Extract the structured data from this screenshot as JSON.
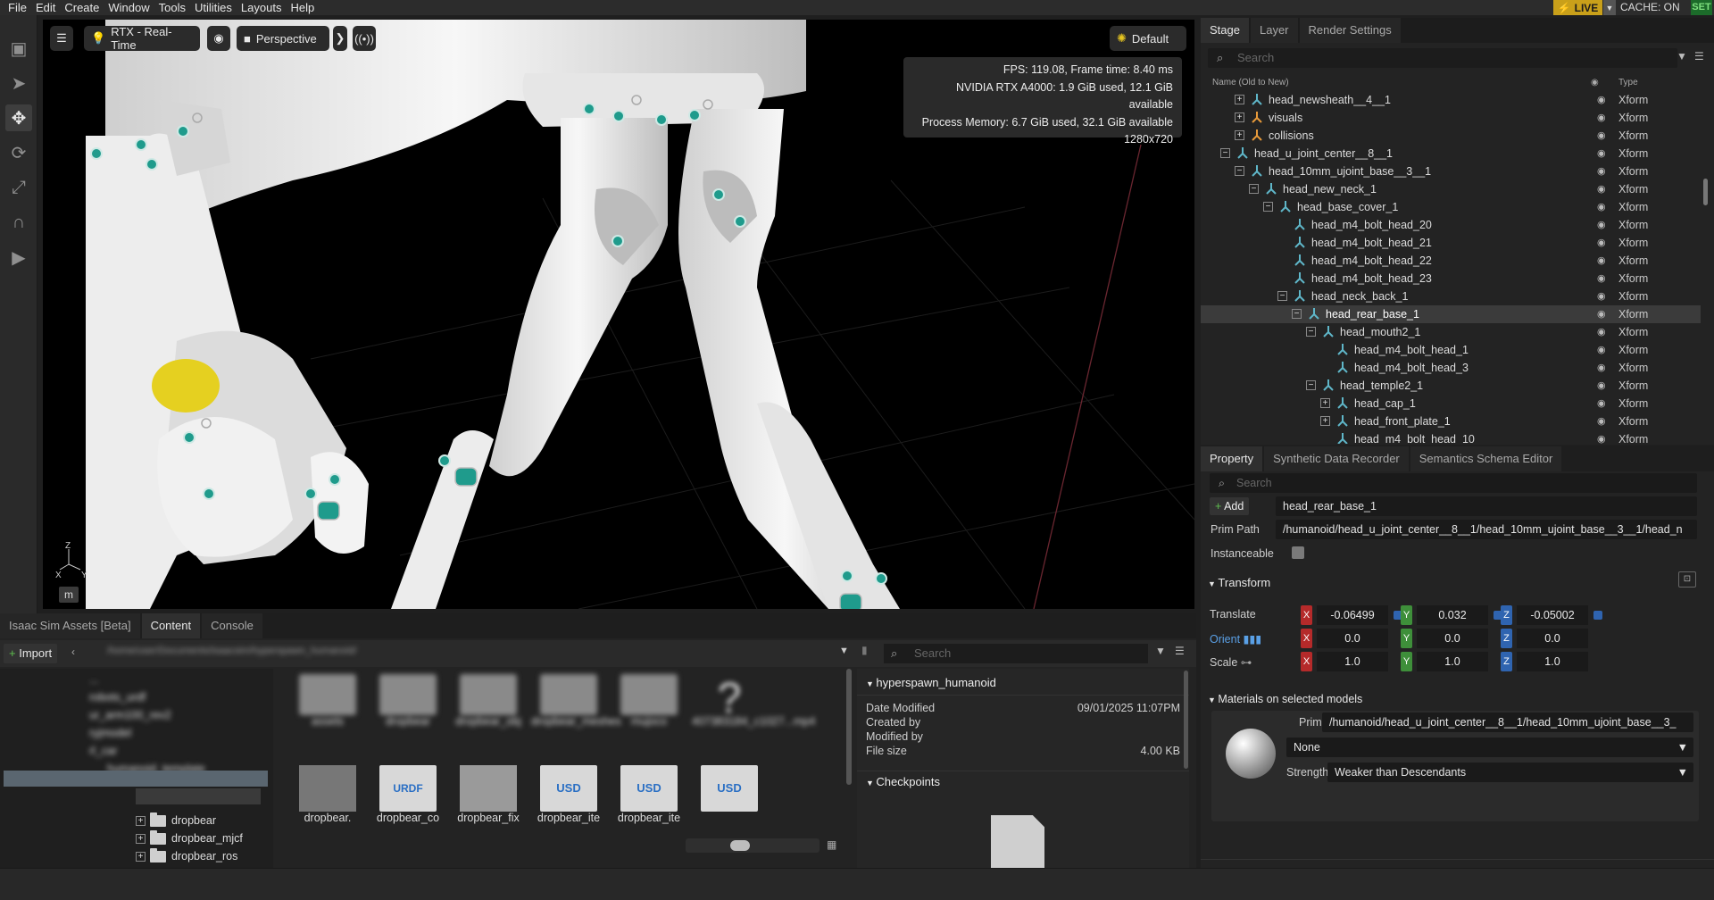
{
  "menu": [
    "File",
    "Edit",
    "Create",
    "Window",
    "Tools",
    "Utilities",
    "Layouts",
    "Help"
  ],
  "status": {
    "live_label": "LIVE",
    "cache_label": "CACHE: ON",
    "set_label": "SET"
  },
  "viewport": {
    "render_mode": "RTX - Real-Time",
    "camera": "Perspective",
    "lighting": "Default",
    "stats": [
      "FPS: 119.08, Frame time: 8.40 ms",
      "NVIDIA RTX A4000: 1.9 GiB used, 12.1 GiB available",
      "Process Memory: 6.7 GiB used, 32.1 GiB available",
      "1280x720"
    ],
    "axis_labels": {
      "z": "Z",
      "x": "X",
      "y": "Y"
    },
    "unit": "m",
    "colors": {
      "joint": "#1f9b8c",
      "part": "#f2f2f2",
      "accent": "#e5d020"
    }
  },
  "content": {
    "tabs": [
      "Isaac Sim Assets [Beta]",
      "Content",
      "Console"
    ],
    "active_tab": "Content",
    "import_label": "Import",
    "path": "/home/user/Documents/isaacsim/hyperspawn_humanoid/",
    "search_placeholder": "Search",
    "tree_blurred": [
      "...",
      "robots_urdf",
      "ur_arm100_rev2",
      "ryjmodel",
      "rl_car",
      "humanoid_template"
    ],
    "tree_visible": [
      {
        "label": "dropbear",
        "expander": "+"
      },
      {
        "label": "dropbear_mjcf",
        "expander": "+"
      },
      {
        "label": "dropbear_ros",
        "expander": "+"
      }
    ],
    "grid_blurred": [
      "assets",
      "dropbear",
      "dropbear_obj",
      "dropbear_meshes",
      "mujoco",
      "407383184_c1027...mp4"
    ],
    "grid_visible": [
      "dropbear.",
      "dropbear_co",
      "dropbear_fix",
      "dropbear_ite",
      "dropbear_ite"
    ],
    "grid_badges": [
      "",
      "URDF",
      "",
      "USD",
      "USD",
      "USD"
    ],
    "details": {
      "name": "hyperspawn_humanoid",
      "date_label": "Date Modified",
      "date_value": "09/01/2025 11:07PM",
      "created_label": "Created by",
      "modified_label": "Modified by",
      "size_label": "File size",
      "size_value": "4.00 KB",
      "checkpoints_label": "Checkpoints"
    }
  },
  "stage": {
    "tabs": [
      "Stage",
      "Layer",
      "Render Settings"
    ],
    "search_placeholder": "Search",
    "col_name": "Name (Old to New)",
    "col_type": "Type",
    "rows": [
      {
        "label": "head_newsheath__4__1",
        "depth": 2,
        "exp": "+",
        "type": "Xform"
      },
      {
        "label": "visuals",
        "depth": 2,
        "exp": "+",
        "type": "Xform",
        "icon": "orange"
      },
      {
        "label": "collisions",
        "depth": 2,
        "exp": "+",
        "type": "Xform",
        "icon": "orange"
      },
      {
        "label": "head_u_joint_center__8__1",
        "depth": 1,
        "exp": "-",
        "type": "Xform"
      },
      {
        "label": "head_10mm_ujoint_base__3__1",
        "depth": 2,
        "exp": "-",
        "type": "Xform"
      },
      {
        "label": "head_new_neck_1",
        "depth": 3,
        "exp": "-",
        "type": "Xform"
      },
      {
        "label": "head_base_cover_1",
        "depth": 4,
        "exp": "-",
        "type": "Xform"
      },
      {
        "label": "head_m4_bolt_head_20",
        "depth": 5,
        "exp": "",
        "type": "Xform"
      },
      {
        "label": "head_m4_bolt_head_21",
        "depth": 5,
        "exp": "",
        "type": "Xform"
      },
      {
        "label": "head_m4_bolt_head_22",
        "depth": 5,
        "exp": "",
        "type": "Xform"
      },
      {
        "label": "head_m4_bolt_head_23",
        "depth": 5,
        "exp": "",
        "type": "Xform"
      },
      {
        "label": "head_neck_back_1",
        "depth": 5,
        "exp": "-",
        "type": "Xform"
      },
      {
        "label": "head_rear_base_1",
        "depth": 6,
        "exp": "-",
        "type": "Xform",
        "selected": true
      },
      {
        "label": "head_mouth2_1",
        "depth": 7,
        "exp": "-",
        "type": "Xform"
      },
      {
        "label": "head_m4_bolt_head_1",
        "depth": 8,
        "exp": "",
        "type": "Xform"
      },
      {
        "label": "head_m4_bolt_head_3",
        "depth": 8,
        "exp": "",
        "type": "Xform"
      },
      {
        "label": "head_temple2_1",
        "depth": 7,
        "exp": "-",
        "type": "Xform"
      },
      {
        "label": "head_cap_1",
        "depth": 8,
        "exp": "+",
        "type": "Xform"
      },
      {
        "label": "head_front_plate_1",
        "depth": 8,
        "exp": "+",
        "type": "Xform"
      },
      {
        "label": "head_m4_bolt_head_10",
        "depth": 8,
        "exp": "",
        "type": "Xform"
      }
    ]
  },
  "property": {
    "tabs": [
      "Property",
      "Synthetic Data Recorder",
      "Semantics Schema Editor"
    ],
    "search_placeholder": "Search",
    "add_label": "Add",
    "prim_name": "head_rear_base_1",
    "prim_path_label": "Prim Path",
    "prim_path": "/humanoid/head_u_joint_center__8__1/head_10mm_ujoint_base__3__1/head_n",
    "instanceable_label": "Instanceable",
    "transform_label": "Transform",
    "translate_label": "Translate",
    "translate": [
      "-0.06499",
      "0.032",
      "-0.05002"
    ],
    "orient_label": "Orient",
    "orient": [
      "0.0",
      "0.0",
      "0.0"
    ],
    "scale_label": "Scale",
    "scale": [
      "1.0",
      "1.0",
      "1.0"
    ],
    "axis": [
      "X",
      "Y",
      "Z"
    ],
    "materials_label": "Materials on selected models",
    "prim_label": "Prim",
    "material_prim": "/humanoid/head_u_joint_center__8__1/head_10mm_ujoint_base__3_",
    "material_value": "None",
    "strength_label": "Strength",
    "strength_value": "Weaker than Descendants",
    "axis_colors": {
      "x": "#b52a2a",
      "y": "#3e8f3a",
      "z": "#2f64b0"
    }
  }
}
